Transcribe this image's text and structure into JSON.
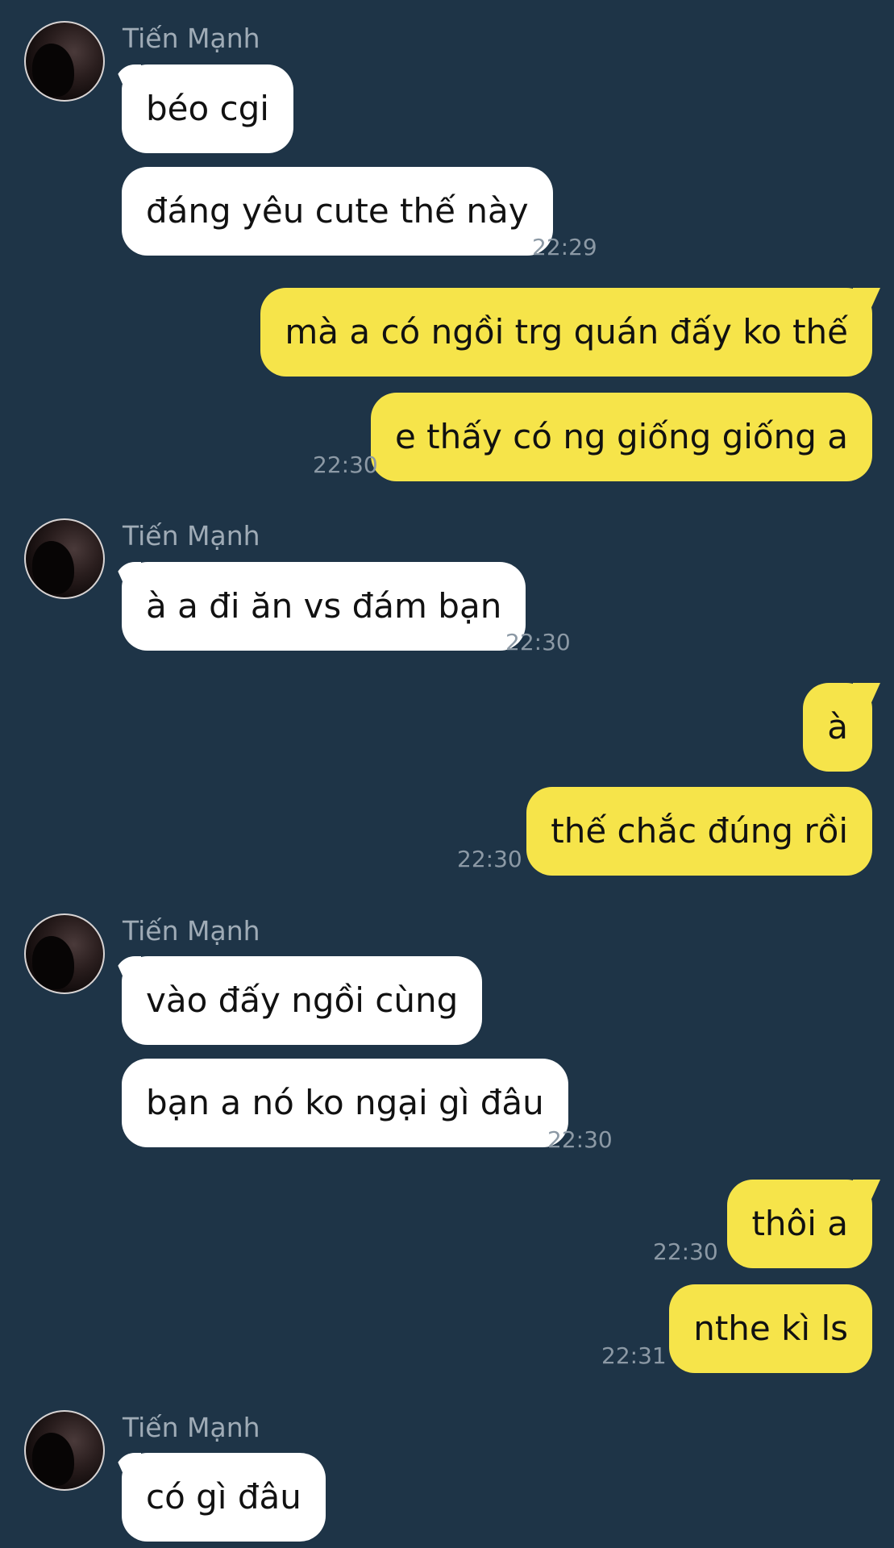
{
  "contact": {
    "name": "Tiến Mạnh"
  },
  "messages": [
    {
      "text": "béo cgi"
    },
    {
      "text": "đáng yêu cute thế này",
      "time": "22:29"
    },
    {
      "text": "mà a có ngồi trg quán đấy ko thế"
    },
    {
      "text": "e thấy có ng giống giống a",
      "time": "22:30"
    },
    {
      "text": "à a đi ăn vs đám bạn",
      "time": "22:30"
    },
    {
      "text": "à"
    },
    {
      "text": "thế chắc đúng rồi",
      "time": "22:30"
    },
    {
      "text": "vào đấy ngồi cùng"
    },
    {
      "text": "bạn a nó ko ngại gì đâu",
      "time": "22:30"
    },
    {
      "text": "thôi a",
      "time": "22:30"
    },
    {
      "text": "nthe kì ls",
      "time": "22:31"
    },
    {
      "text": "có gì đâu"
    }
  ],
  "colors": {
    "background": "#1e3447",
    "incoming_bubble": "#ffffff",
    "outgoing_bubble": "#f6e44a",
    "sender_name": "#9fabb6",
    "timestamp": "#8c99a5"
  },
  "icons": {
    "avatar": "contact-avatar-photo"
  }
}
